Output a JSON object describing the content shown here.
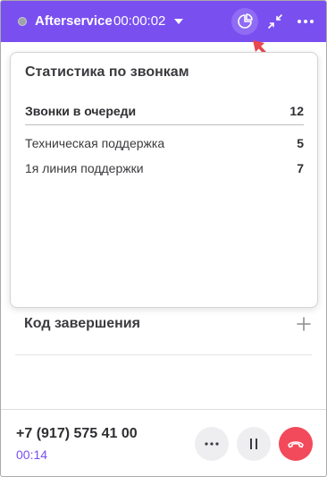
{
  "header": {
    "status_name": "Afterservice",
    "status_time": "00:00:02",
    "colors": {
      "accent": "#7a4ff0",
      "status_dot": "#9ea3a8"
    },
    "icons": [
      "status-dot-icon",
      "caret-down-icon",
      "pie-chart-icon",
      "collapse-icon",
      "more-horizontal-icon"
    ]
  },
  "popover": {
    "title": "Статистика по звонкам",
    "queue_label": "Звонки в очереди",
    "queue_value": "12",
    "queues": [
      {
        "label": "Техническая поддержка",
        "value": "5"
      },
      {
        "label": "1я линия поддержки",
        "value": "7"
      }
    ]
  },
  "main": {
    "completion_label": "Код завершения",
    "add_icon": "plus-icon"
  },
  "footer": {
    "phone": "+7 (917) 575 41 00",
    "duration": "00:14",
    "hangup_color": "#f24a5a"
  }
}
